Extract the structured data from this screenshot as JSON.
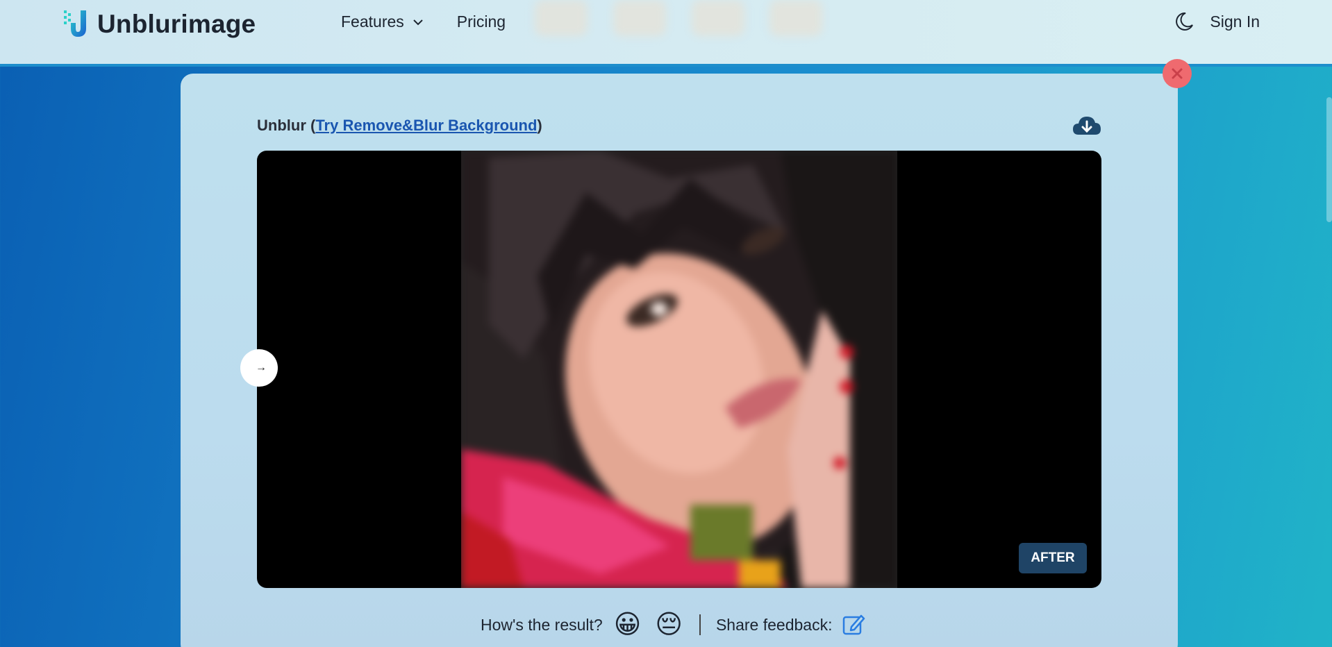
{
  "header": {
    "logo_text": "Unblurimage",
    "nav": [
      {
        "label": "Features",
        "has_dropdown": true
      },
      {
        "label": "Pricing",
        "has_dropdown": false
      }
    ],
    "theme_icon": "moon-icon",
    "signin_label": "Sign In"
  },
  "modal": {
    "title_prefix": "Unblur (",
    "title_link": "Try Remove&Blur Background",
    "title_suffix": ")",
    "download_icon": "cloud-download-icon",
    "close_icon": "close-icon",
    "slider_handle_icon": "arrow-right-icon",
    "badge": "AFTER",
    "feedback_question": "How's the result?",
    "emoji_good": "😀",
    "emoji_bad": "😔",
    "share_label": "Share feedback:",
    "share_icon": "edit-icon"
  },
  "colors": {
    "accent": "#1a56b0",
    "badge_bg": "#1f4466",
    "close_bg": "#ef6a6f"
  }
}
